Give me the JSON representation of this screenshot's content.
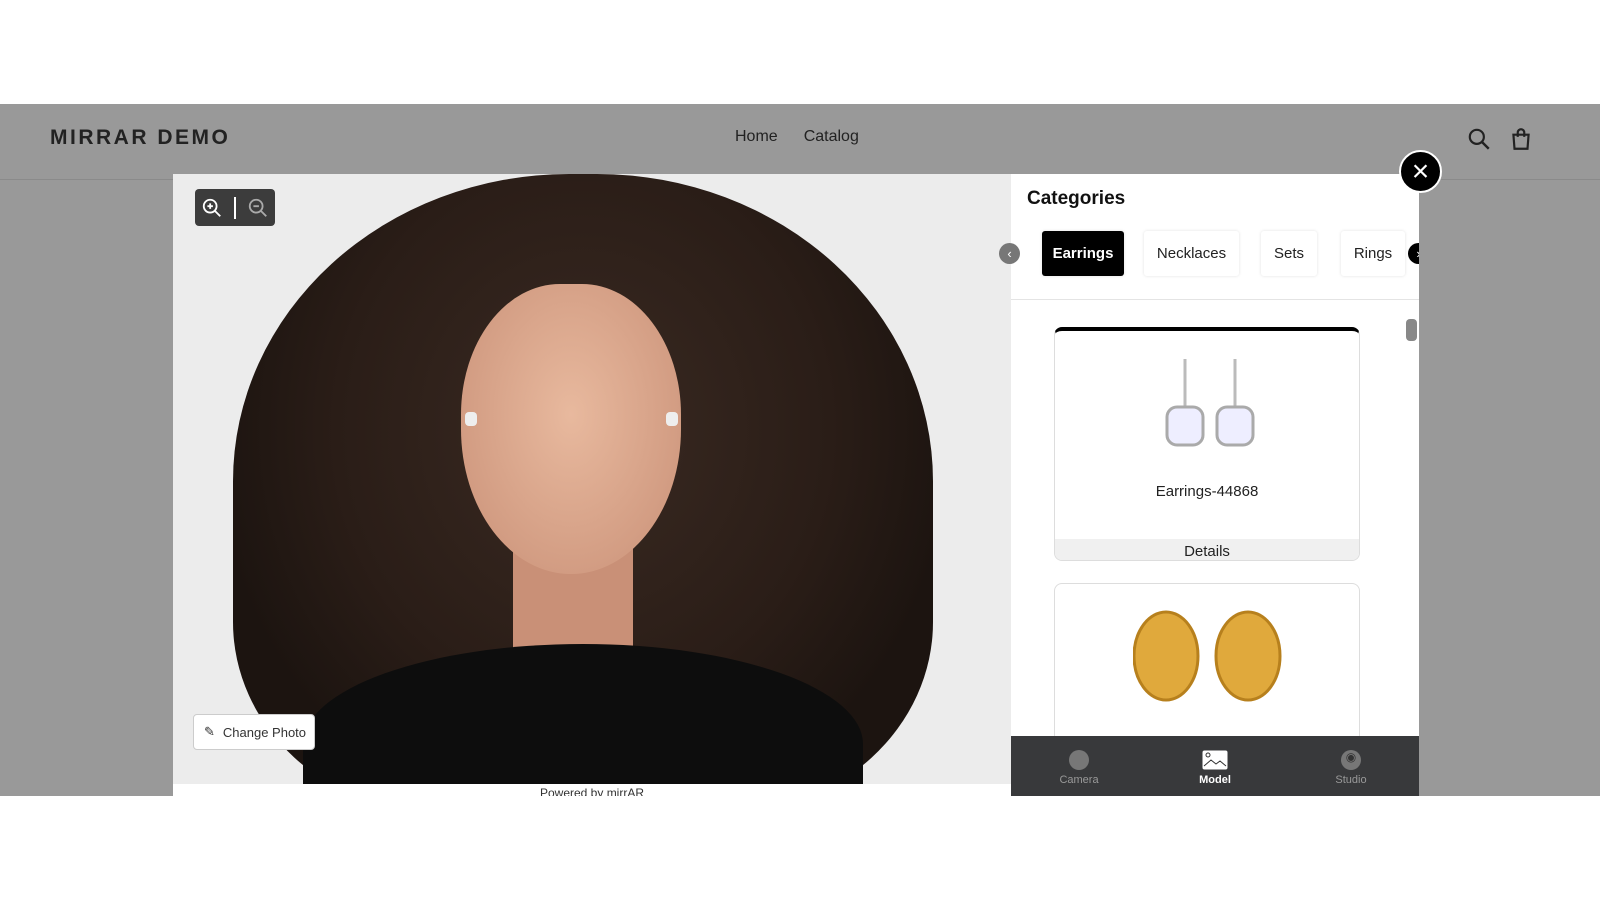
{
  "header": {
    "brand": "MIRRAR DEMO",
    "nav": [
      "Home",
      "Catalog"
    ],
    "icons": [
      "search-icon",
      "cart-icon"
    ]
  },
  "viewer": {
    "zoom_in": "zoom-in-icon",
    "zoom_out": "zoom-out-icon",
    "change_photo": "Change Photo",
    "powered_by": "Powered by mirrAR"
  },
  "panel": {
    "title": "Categories",
    "tabs": [
      {
        "label": "Earrings",
        "active": true
      },
      {
        "label": "Necklaces"
      },
      {
        "label": "Sets"
      },
      {
        "label": "Rings"
      }
    ],
    "products": [
      {
        "name": "Earrings-44868",
        "details": "Details"
      },
      {
        "name": "",
        "details": ""
      }
    ],
    "bottom_nav": [
      {
        "label": "Camera"
      },
      {
        "label": "Model",
        "active": true
      },
      {
        "label": "Studio"
      }
    ]
  },
  "colors": {
    "active_tab": "#000000",
    "bottom_bar": "#38393b",
    "backdrop": "#999999"
  }
}
